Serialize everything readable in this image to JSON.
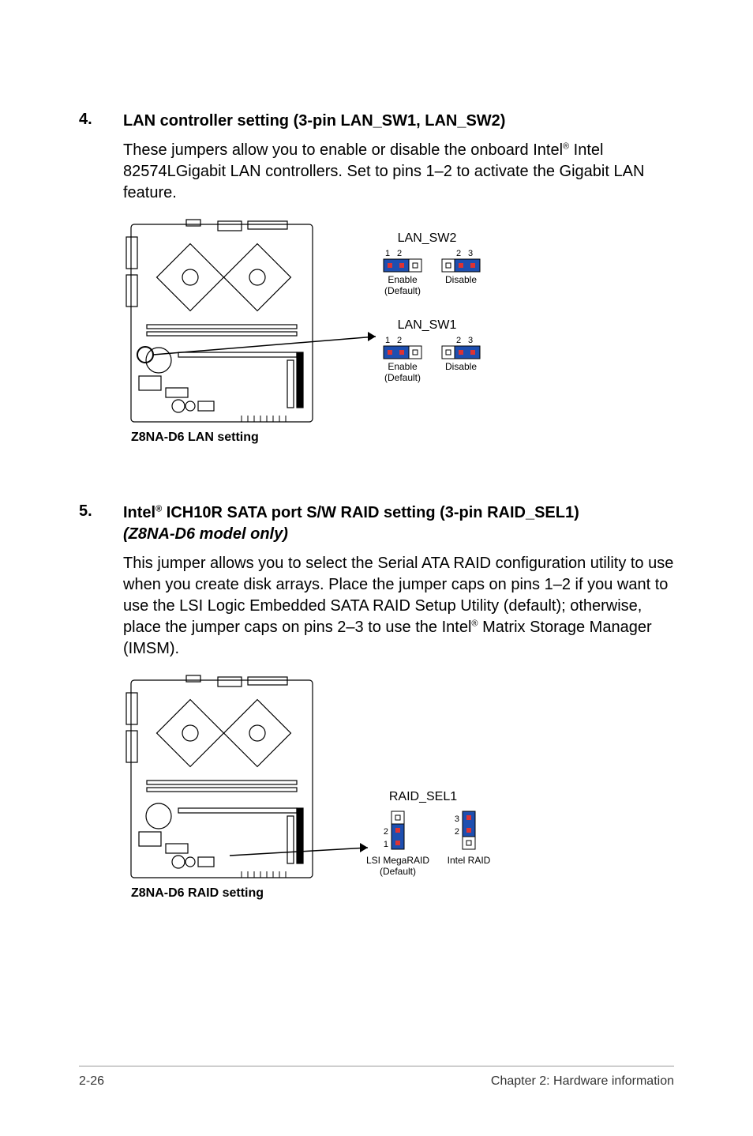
{
  "section4": {
    "num": "4.",
    "title": "LAN controller setting (3-pin LAN_SW1, LAN_SW2)",
    "body_a": "These jumpers allow you to enable or disable the onboard Intel",
    "body_sup": "®",
    "body_b": " Intel 82574LGigabit LAN controllers. Set to pins 1–2 to activate the Gigabit LAN feature.",
    "diagram": {
      "caption": "Z8NA-D6 LAN setting",
      "sw2_label": "LAN_SW2",
      "sw1_label": "LAN_SW1",
      "enable": "Enable",
      "default": "(Default)",
      "disable": "Disable",
      "pin1": "1",
      "pin2": "2",
      "pin3": "3"
    }
  },
  "section5": {
    "num": "5.",
    "title_a": "Intel",
    "title_sup": "®",
    "title_b": " ICH10R SATA port S/W RAID setting (3-pin RAID_SEL1)",
    "subtitle": "(Z8NA-D6 model only)",
    "body_a": "This jumper allows you to select the Serial ATA RAID configuration utility to use when you create disk arrays. Place the jumper caps on pins 1–2 if you want to use the LSI Logic Embedded SATA RAID Setup Utility (default); otherwise, place the jumper caps on pins 2–3 to use the Intel",
    "body_sup": "®",
    "body_b": " Matrix Storage Manager (IMSM).",
    "diagram": {
      "caption": "Z8NA-D6 RAID setting",
      "header": "RAID_SEL1",
      "lsi": "LSI MegaRAID",
      "default": "(Default)",
      "intel": "Intel RAID",
      "pin1": "1",
      "pin2": "2",
      "pin3": "3"
    }
  },
  "footer": {
    "left": "2-26",
    "right": "Chapter 2: Hardware information"
  }
}
